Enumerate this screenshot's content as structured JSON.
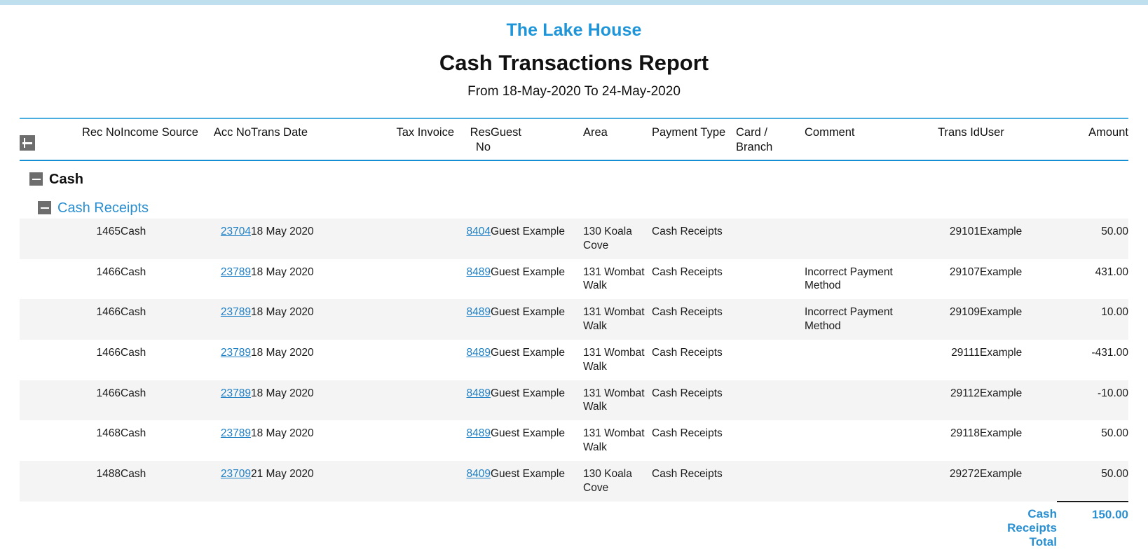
{
  "report": {
    "company": "The Lake House",
    "title": "Cash Transactions Report",
    "date_range": "From 18-May-2020 To 24-May-2020",
    "accent_color": "#1e95d8",
    "link_color": "#1e7fc4",
    "header_rule_color": "#168ed4",
    "stripe_color": "#f4f4f4"
  },
  "table": {
    "expand_all_icon": "plus-square-icon",
    "columns": [
      {
        "key": "rec_no",
        "label": "Rec No",
        "align": "right"
      },
      {
        "key": "income_src",
        "label": "Income Source",
        "align": "left"
      },
      {
        "key": "acc_no",
        "label": "Acc No",
        "align": "right"
      },
      {
        "key": "trans_date",
        "label": "Trans Date",
        "align": "left"
      },
      {
        "key": "tax_invoice",
        "label": "Tax Invoice",
        "align": "right"
      },
      {
        "key": "res_no",
        "label": "Res No",
        "align": "right"
      },
      {
        "key": "guest",
        "label": "Guest",
        "align": "left"
      },
      {
        "key": "area",
        "label": "Area",
        "align": "left"
      },
      {
        "key": "payment_type",
        "label": "Payment Type",
        "align": "left"
      },
      {
        "key": "card_branch",
        "label": "Card / Branch",
        "align": "left"
      },
      {
        "key": "comment",
        "label": "Comment",
        "align": "left"
      },
      {
        "key": "trans_id",
        "label": "Trans Id",
        "align": "right"
      },
      {
        "key": "user",
        "label": "User",
        "align": "left"
      },
      {
        "key": "amount",
        "label": "Amount",
        "align": "right"
      }
    ],
    "groups": [
      {
        "level": 1,
        "label": "Cash",
        "collapse_icon": "minus-square-icon",
        "subgroups": [
          {
            "level": 2,
            "label": "Cash Receipts",
            "collapse_icon": "minus-square-icon",
            "rows": [
              {
                "rec_no": "1465",
                "income_src": "Cash",
                "acc_no": "23704",
                "trans_date": "18 May 2020",
                "tax_invoice": "",
                "res_no": "8404",
                "guest": "Guest Example",
                "area": "130 Koala Cove",
                "payment_type": "Cash Receipts",
                "card_branch": "",
                "comment": "",
                "trans_id": "29101",
                "user": "Example",
                "amount": "50.00"
              },
              {
                "rec_no": "1466",
                "income_src": "Cash",
                "acc_no": "23789",
                "trans_date": "18 May 2020",
                "tax_invoice": "",
                "res_no": "8489",
                "guest": "Guest Example",
                "area": "131 Wombat Walk",
                "payment_type": "Cash Receipts",
                "card_branch": "",
                "comment": " Incorrect Payment Method",
                "trans_id": "29107",
                "user": "Example",
                "amount": "431.00"
              },
              {
                "rec_no": "1466",
                "income_src": "Cash",
                "acc_no": "23789",
                "trans_date": "18 May 2020",
                "tax_invoice": "",
                "res_no": "8489",
                "guest": "Guest Example",
                "area": "131 Wombat Walk",
                "payment_type": "Cash Receipts",
                "card_branch": "",
                "comment": " Incorrect Payment Method",
                "trans_id": "29109",
                "user": "Example",
                "amount": "10.00"
              },
              {
                "rec_no": "1466",
                "income_src": "Cash",
                "acc_no": "23789",
                "trans_date": "18 May 2020",
                "tax_invoice": "",
                "res_no": "8489",
                "guest": "Guest Example",
                "area": "131 Wombat Walk",
                "payment_type": "Cash Receipts",
                "card_branch": "",
                "comment": "",
                "trans_id": "29111",
                "user": "Example",
                "amount": "-431.00"
              },
              {
                "rec_no": "1466",
                "income_src": "Cash",
                "acc_no": "23789",
                "trans_date": "18 May 2020",
                "tax_invoice": "",
                "res_no": "8489",
                "guest": "Guest Example",
                "area": "131 Wombat Walk",
                "payment_type": "Cash Receipts",
                "card_branch": "",
                "comment": "",
                "trans_id": "29112",
                "user": "Example",
                "amount": "-10.00"
              },
              {
                "rec_no": "1468",
                "income_src": "Cash",
                "acc_no": "23789",
                "trans_date": "18 May 2020",
                "tax_invoice": "",
                "res_no": "8489",
                "guest": "Guest Example",
                "area": "131 Wombat Walk",
                "payment_type": "Cash Receipts",
                "card_branch": "",
                "comment": "",
                "trans_id": "29118",
                "user": "Example",
                "amount": "50.00"
              },
              {
                "rec_no": "1488",
                "income_src": "Cash",
                "acc_no": "23709",
                "trans_date": "21 May 2020",
                "tax_invoice": "",
                "res_no": "8409",
                "guest": "Guest Example",
                "area": "130 Koala Cove",
                "payment_type": "Cash Receipts",
                "card_branch": "",
                "comment": "",
                "trans_id": "29272",
                "user": "Example",
                "amount": "50.00"
              }
            ],
            "total": {
              "label": "Cash Receipts Total",
              "amount": "150.00"
            }
          }
        ]
      }
    ]
  }
}
